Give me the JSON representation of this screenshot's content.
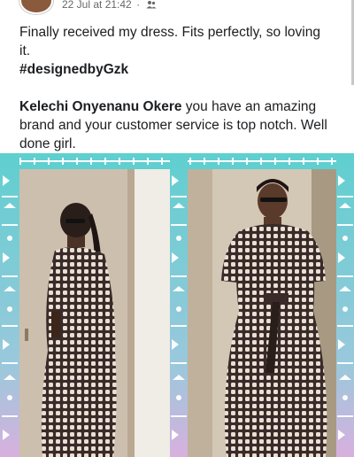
{
  "post": {
    "timestamp": "22 Jul at 21:42",
    "separator": "·",
    "audience_icon": "friends-icon",
    "body_line1": "Finally received my dress. Fits perfectly, so loving it.",
    "hashtag": "#designedbyGzk",
    "mention": "Kelechi Onyenanu Okere",
    "body_line2": " you have an amazing brand and your customer service is top notch. Well done girl."
  },
  "colors": {
    "teal": "#5fcfcf",
    "lilac": "#d8b0de",
    "dress_dark": "#3a2b2a",
    "dress_light": "#e8e0d2",
    "door_wall": "#cdbfae"
  }
}
